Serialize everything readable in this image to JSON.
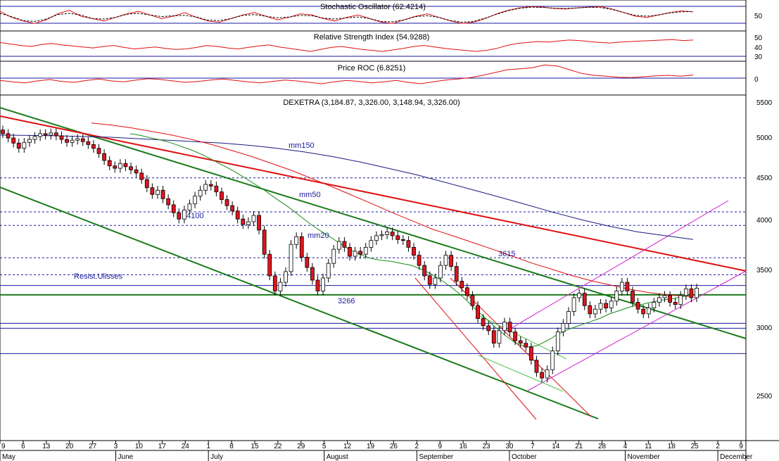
{
  "chart_data": {
    "type": "candlestick",
    "panels": {
      "stochastic": {
        "title": "Stochastic Oscillator (62.4214)",
        "ticks": [
          "50"
        ]
      },
      "rsi": {
        "title": "Relative Strength Index (54.9288)",
        "ticks": [
          "50",
          "40",
          "30"
        ]
      },
      "roc": {
        "title": "Price ROC (6.8251)",
        "ticks": [
          "0"
        ]
      },
      "price": {
        "title": "DEXETRA (3,184.87, 3,326.00, 3,148.94, 3,326.00)"
      }
    },
    "y_axis": {
      "scale": "log",
      "range": [
        2250,
        5550
      ],
      "ticks": [
        2500,
        3000,
        3500,
        4000,
        4500,
        5000,
        5500
      ]
    },
    "y_tick_labels": [
      "2500",
      "3000",
      "3500",
      "4000",
      "4500",
      "5000",
      "5500"
    ],
    "x_axis": {
      "day_labels": [
        "9",
        "6",
        "13",
        "20",
        "27",
        "3",
        "10",
        "17",
        "24",
        "1",
        "8",
        "15",
        "22",
        "29",
        "5",
        "12",
        "19",
        "26",
        "2",
        "9",
        "16",
        "23",
        "30",
        "7",
        "14",
        "21",
        "28",
        "4",
        "11",
        "18",
        "25",
        "2",
        "9"
      ],
      "month_labels": [
        "May",
        "June",
        "July",
        "August",
        "September",
        "October",
        "November",
        "December"
      ]
    },
    "annotations": [
      {
        "text": "mm150",
        "color": "#1a1aa0"
      },
      {
        "text": "mm50",
        "color": "#1a1aa0"
      },
      {
        "text": "mm20",
        "color": "#1a1aa0"
      },
      {
        "text": "4100",
        "color": "#1a1aa0"
      },
      {
        "text": "3615",
        "color": "#1a1aa0"
      },
      {
        "text": "3266",
        "color": "#1a1aa0"
      },
      {
        "text": "Resist.Ulisses",
        "color": "#1a1aa0"
      }
    ],
    "horizontal_levels": [
      {
        "value": 4500,
        "style": "dashed",
        "color": "#1a1aa0"
      },
      {
        "value": 4100,
        "style": "dashed",
        "color": "#1a1aa0"
      },
      {
        "value": 3950,
        "style": "dashed",
        "color": "#1a1aa0"
      },
      {
        "value": 3615,
        "style": "dashed",
        "color": "#1a1aa0"
      },
      {
        "value": 3450,
        "style": "dashed",
        "color": "#1a1aa0"
      },
      {
        "value": 3350,
        "style": "solid",
        "color": "#1a1aa0"
      },
      {
        "value": 3266,
        "style": "solid-thick",
        "color": "#1a7a1a"
      },
      {
        "value": 3020,
        "style": "solid",
        "color": "#1a1aa0"
      },
      {
        "value": 2980,
        "style": "solid",
        "color": "#1a1aa0"
      },
      {
        "value": 2780,
        "style": "solid",
        "color": "#1a1aa0"
      }
    ],
    "colors": {
      "up": "#ffffff",
      "down": "#e0141e",
      "ma150": "#1a1a80",
      "ma50": "#e01010",
      "ma20": "#1a8a1a",
      "trend_red": "#e01010",
      "trend_green": "#1a7a1a",
      "channel": "#d020d0"
    },
    "candles_close": [
      5080,
      5020,
      4950,
      4880,
      4960,
      5000,
      5040,
      5080,
      5060,
      5090,
      5050,
      5000,
      4960,
      4990,
      5010,
      4970,
      4930,
      4880,
      4810,
      4720,
      4650,
      4620,
      4680,
      4640,
      4600,
      4560,
      4480,
      4380,
      4300,
      4350,
      4250,
      4180,
      4090,
      4020,
      4120,
      4190,
      4280,
      4350,
      4420,
      4400,
      4330,
      4240,
      4170,
      4110,
      4020,
      3960,
      3990,
      4060,
      3900,
      3650,
      3440,
      3300,
      3380,
      3480,
      3750,
      3830,
      3620,
      3520,
      3400,
      3300,
      3420,
      3560,
      3700,
      3780,
      3720,
      3630,
      3680,
      3650,
      3720,
      3790,
      3840,
      3850,
      3880,
      3840,
      3800,
      3790,
      3720,
      3640,
      3540,
      3440,
      3360,
      3420,
      3540,
      3640,
      3530,
      3390,
      3330,
      3260,
      3170,
      3060,
      3000,
      2960,
      2860,
      2960,
      3030,
      2950,
      2880,
      2860,
      2830,
      2730,
      2640,
      2600,
      2660,
      2800,
      2950,
      3020,
      3120,
      3240,
      3280,
      3170,
      3100,
      3140,
      3190,
      3150,
      3210,
      3300,
      3380,
      3300,
      3200,
      3140,
      3100,
      3150,
      3200,
      3240,
      3260,
      3200,
      3180,
      3260,
      3320,
      3240,
      3326
    ],
    "ma20": [
      5080,
      5055,
      5020,
      4990,
      4950,
      4900,
      4850,
      4790,
      4720,
      4650,
      4580,
      4500,
      4420,
      4340,
      4250,
      4170,
      4080,
      3990,
      3910,
      3840,
      3770,
      3700,
      3650,
      3610,
      3590,
      3580,
      3560,
      3540,
      3500,
      3450,
      3390,
      3320,
      3240,
      3150,
      3070,
      2990,
      2920,
      2860,
      2830,
      2840,
      2880,
      2930,
      2970,
      3000,
      3030,
      3060,
      3100,
      3130,
      3160,
      3180,
      3200,
      3220,
      3230,
      3250,
      3270
    ],
    "ma50": [
      5230,
      5200,
      5160,
      5110,
      5060,
      5000,
      4930,
      4850,
      4770,
      4680,
      4590,
      4490,
      4390,
      4290,
      4190,
      4090,
      4000,
      3910,
      3840,
      3770,
      3700,
      3630,
      3560,
      3500,
      3440,
      3390,
      3350,
      3310,
      3280,
      3260,
      3250
    ],
    "ma150": [
      5060,
      5055,
      5050,
      5040,
      5030,
      5010,
      4990,
      4970,
      4950,
      4920,
      4880,
      4830,
      4770,
      4700,
      4620,
      4540,
      4450,
      4360,
      4270,
      4180,
      4090,
      4010,
      3940,
      3880,
      3840,
      3800
    ],
    "stochastic": [
      70,
      45,
      30,
      20,
      35,
      60,
      75,
      50,
      40,
      30,
      45,
      60,
      70,
      55,
      40,
      50,
      65,
      45,
      30,
      25,
      40,
      55,
      65,
      50,
      35,
      45,
      60,
      55,
      40,
      30,
      45,
      55,
      40,
      25,
      20,
      35,
      50,
      60,
      45,
      30,
      20,
      25,
      40,
      60,
      75,
      85,
      90,
      88,
      82,
      80,
      85,
      88,
      90,
      80,
      65,
      50,
      45,
      55,
      65,
      72,
      68
    ],
    "rsi": [
      58,
      55,
      52,
      50,
      54,
      56,
      53,
      51,
      49,
      47,
      50,
      52,
      48,
      45,
      47,
      49,
      46,
      44,
      45,
      48,
      52,
      50,
      47,
      45,
      48,
      51,
      53,
      49,
      46,
      43,
      40,
      44,
      48,
      50,
      47,
      44,
      42,
      40,
      43,
      46,
      50,
      52,
      49,
      46,
      44,
      42,
      40,
      42,
      46,
      52,
      56,
      58,
      60,
      59,
      61,
      63,
      62,
      60,
      58,
      57,
      59,
      60,
      61,
      62,
      63,
      64,
      62,
      63
    ],
    "roc": [
      -5,
      -8,
      -10,
      -6,
      -3,
      -7,
      -9,
      -5,
      -2,
      -6,
      -8,
      -4,
      -1,
      -3,
      -6,
      -9,
      -7,
      -4,
      -2,
      -5,
      -8,
      -10,
      -7,
      -4,
      -6,
      -9,
      -12,
      -8,
      -5,
      -7,
      -10,
      -8,
      -5,
      -9,
      -12,
      -8,
      -4,
      -2,
      1,
      6,
      12,
      18,
      20,
      22,
      28,
      26,
      18,
      10,
      6,
      4,
      2,
      1,
      3,
      5,
      6,
      4,
      6.8
    ]
  }
}
